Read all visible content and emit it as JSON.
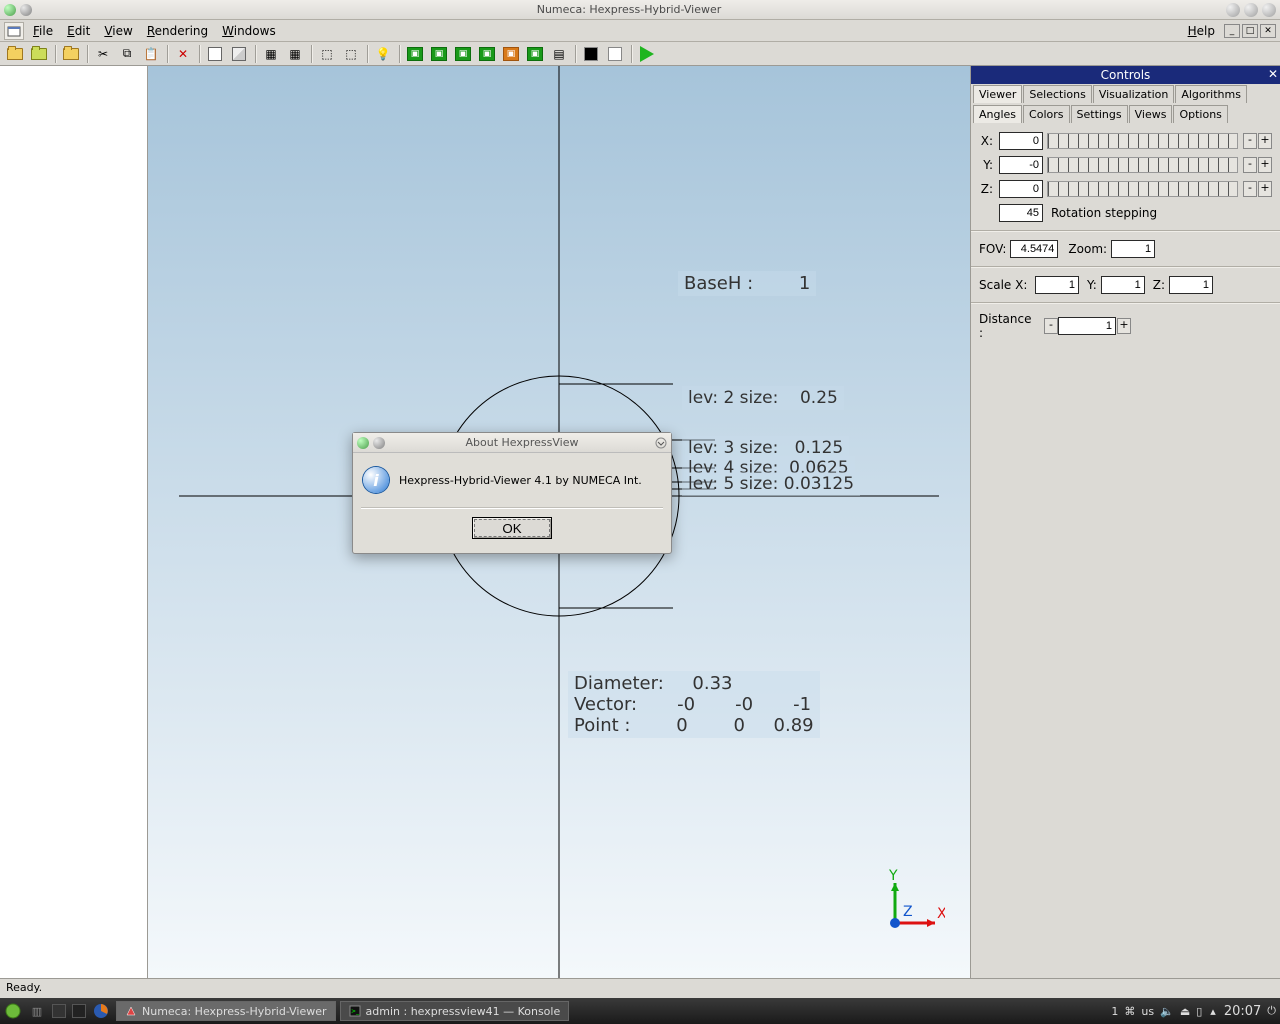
{
  "os": {
    "window_title": "Numeca: Hexpress-Hybrid-Viewer"
  },
  "menu": {
    "file": "File",
    "edit": "Edit",
    "view": "View",
    "rendering": "Rendering",
    "windows": "Windows",
    "help": "Help"
  },
  "status": "Ready.",
  "controls": {
    "title": "Controls",
    "tabs_top": [
      "Viewer",
      "Selections",
      "Visualization",
      "Algorithms"
    ],
    "tabs_bot": [
      "Angles",
      "Colors",
      "Settings",
      "Views",
      "Options"
    ],
    "angles": {
      "x": "0",
      "y": "-0",
      "z": "0",
      "rot_step": "45",
      "rot_label": "Rotation stepping"
    },
    "view": {
      "fov_label": "FOV:",
      "fov": "4.5474",
      "zoom_label": "Zoom:",
      "zoom": "1"
    },
    "scale": {
      "label": "Scale X:",
      "x": "1",
      "y_label": "Y:",
      "y": "1",
      "z_label": "Z:",
      "z": "1"
    },
    "distance": {
      "label": "Distance :",
      "value": "1"
    }
  },
  "viewport": {
    "baseh": "BaseH :        1",
    "levs": [
      "lev: 2 size:    0.25",
      "lev: 3 size:   0.125",
      "lev: 4 size:  0.0625",
      "lev: 5 size: 0.03125"
    ],
    "info": "Diameter:     0.33\nVector:       -0       -0       -1\nPoint :        0        0     0.89",
    "axis": {
      "x": "X",
      "y": "Y",
      "z": "Z"
    }
  },
  "dialog": {
    "title": "About HexpressView",
    "text": "Hexpress-Hybrid-Viewer 4.1 by NUMECA Int.",
    "ok": "OK"
  },
  "taskbar": {
    "task1": "Numeca: Hexpress-Hybrid-Viewer",
    "task2": "admin : hexpressview41 — Konsole",
    "ws": "1",
    "layout": "us",
    "time": "20:07"
  }
}
